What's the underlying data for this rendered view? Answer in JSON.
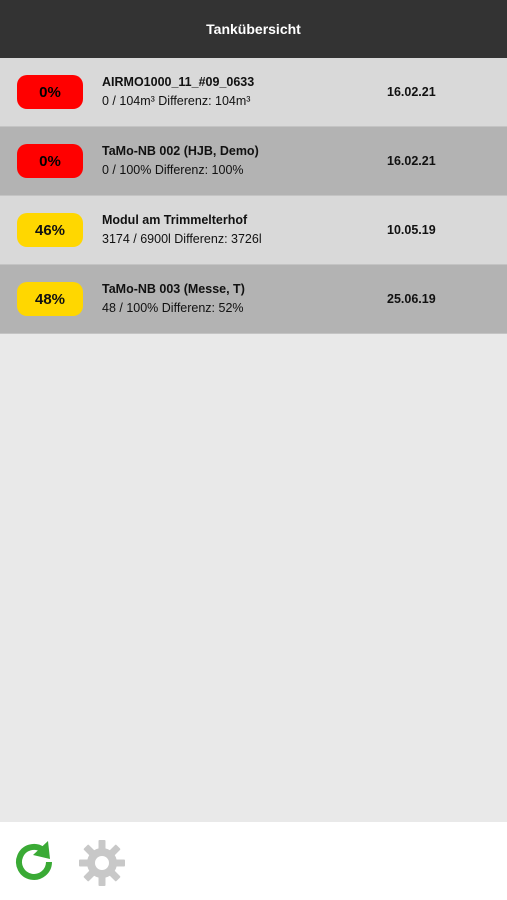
{
  "header": {
    "title": "Tankübersicht"
  },
  "tanks": [
    {
      "percent": "0%",
      "level_color": "red",
      "name": "AIRMO1000_11_#09_0633",
      "detail": "0 / 104m³ Differenz: 104m³",
      "date": "16.02.21"
    },
    {
      "percent": "0%",
      "level_color": "red",
      "name": "TaMo-NB 002 (HJB, Demo)",
      "detail": "0 / 100% Differenz: 100%",
      "date": "16.02.21"
    },
    {
      "percent": "46%",
      "level_color": "yellow",
      "name": "Modul am Trimmelterhof",
      "detail": "3174 / 6900l Differenz: 3726l",
      "date": "10.05.19"
    },
    {
      "percent": "48%",
      "level_color": "yellow",
      "name": "TaMo-NB 003 (Messe, T)",
      "detail": "48 / 100% Differenz: 52%",
      "date": "25.06.19"
    }
  ],
  "footer": {
    "refresh_icon": "refresh-icon",
    "settings_icon": "gear-icon"
  },
  "colors": {
    "header_bg": "#333333",
    "red": "#ff0000",
    "yellow": "#ffd700",
    "refresh_green": "#3aaa35",
    "gear_gray": "#c8c8c8"
  }
}
